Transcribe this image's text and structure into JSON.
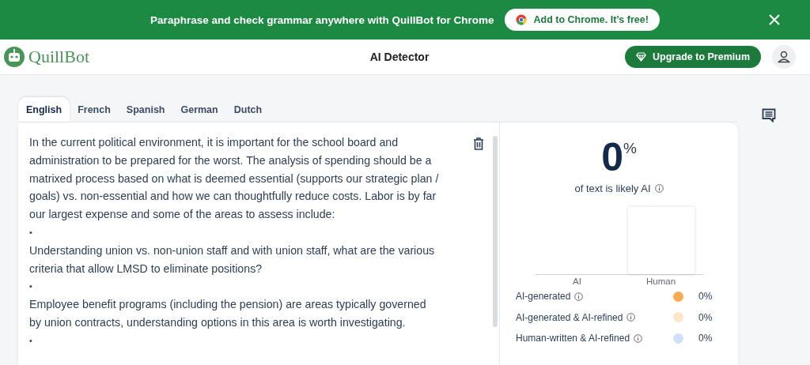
{
  "banner": {
    "message": "Paraphrase and check grammar anywhere with QuillBot for Chrome",
    "cta": "Add to Chrome. It’s free!"
  },
  "header": {
    "logo": "QuillBot",
    "title": "AI Detector",
    "upgrade": "Upgrade to Premium"
  },
  "tabs": [
    {
      "label": "English",
      "selected": true
    },
    {
      "label": "French",
      "selected": false
    },
    {
      "label": "Spanish",
      "selected": false
    },
    {
      "label": "German",
      "selected": false
    },
    {
      "label": "Dutch",
      "selected": false
    }
  ],
  "editor": {
    "paragraphs": [
      {
        "kind": "text",
        "text": "In the current political environment, it is important for the school board and administration to be prepared for the worst. The analysis of spending should be a matrixed process based on what is deemed essential (supports our strategic plan / goals) vs. non-essential and how we can thoughtfully reduce costs. Labor is by far our largest expense and some of the areas to assess include:"
      },
      {
        "kind": "bullet",
        "text": "•"
      },
      {
        "kind": "text",
        "text": "Understanding union vs. non-union staff and with union staff, what are the various criteria that allow LMSD to eliminate positions?"
      },
      {
        "kind": "bullet",
        "text": "•"
      },
      {
        "kind": "text",
        "text": "Employee benefit programs (including the pension) are areas typically governed by union contracts, understanding options in this area is worth investigating."
      },
      {
        "kind": "bullet",
        "text": "•"
      }
    ]
  },
  "result": {
    "score": "0",
    "unit": "%",
    "caption": "of text is likely AI",
    "bars": [
      {
        "label": "AI"
      },
      {
        "label": "Human"
      }
    ],
    "legend": [
      {
        "label": "AI-generated",
        "color": "#fbab4f",
        "value": "0%"
      },
      {
        "label": "AI-generated & AI-refined",
        "color": "#fde5c8",
        "value": "0%"
      },
      {
        "label": "Human-written & AI-refined",
        "color": "#cfe0fb",
        "value": "0%"
      }
    ]
  }
}
